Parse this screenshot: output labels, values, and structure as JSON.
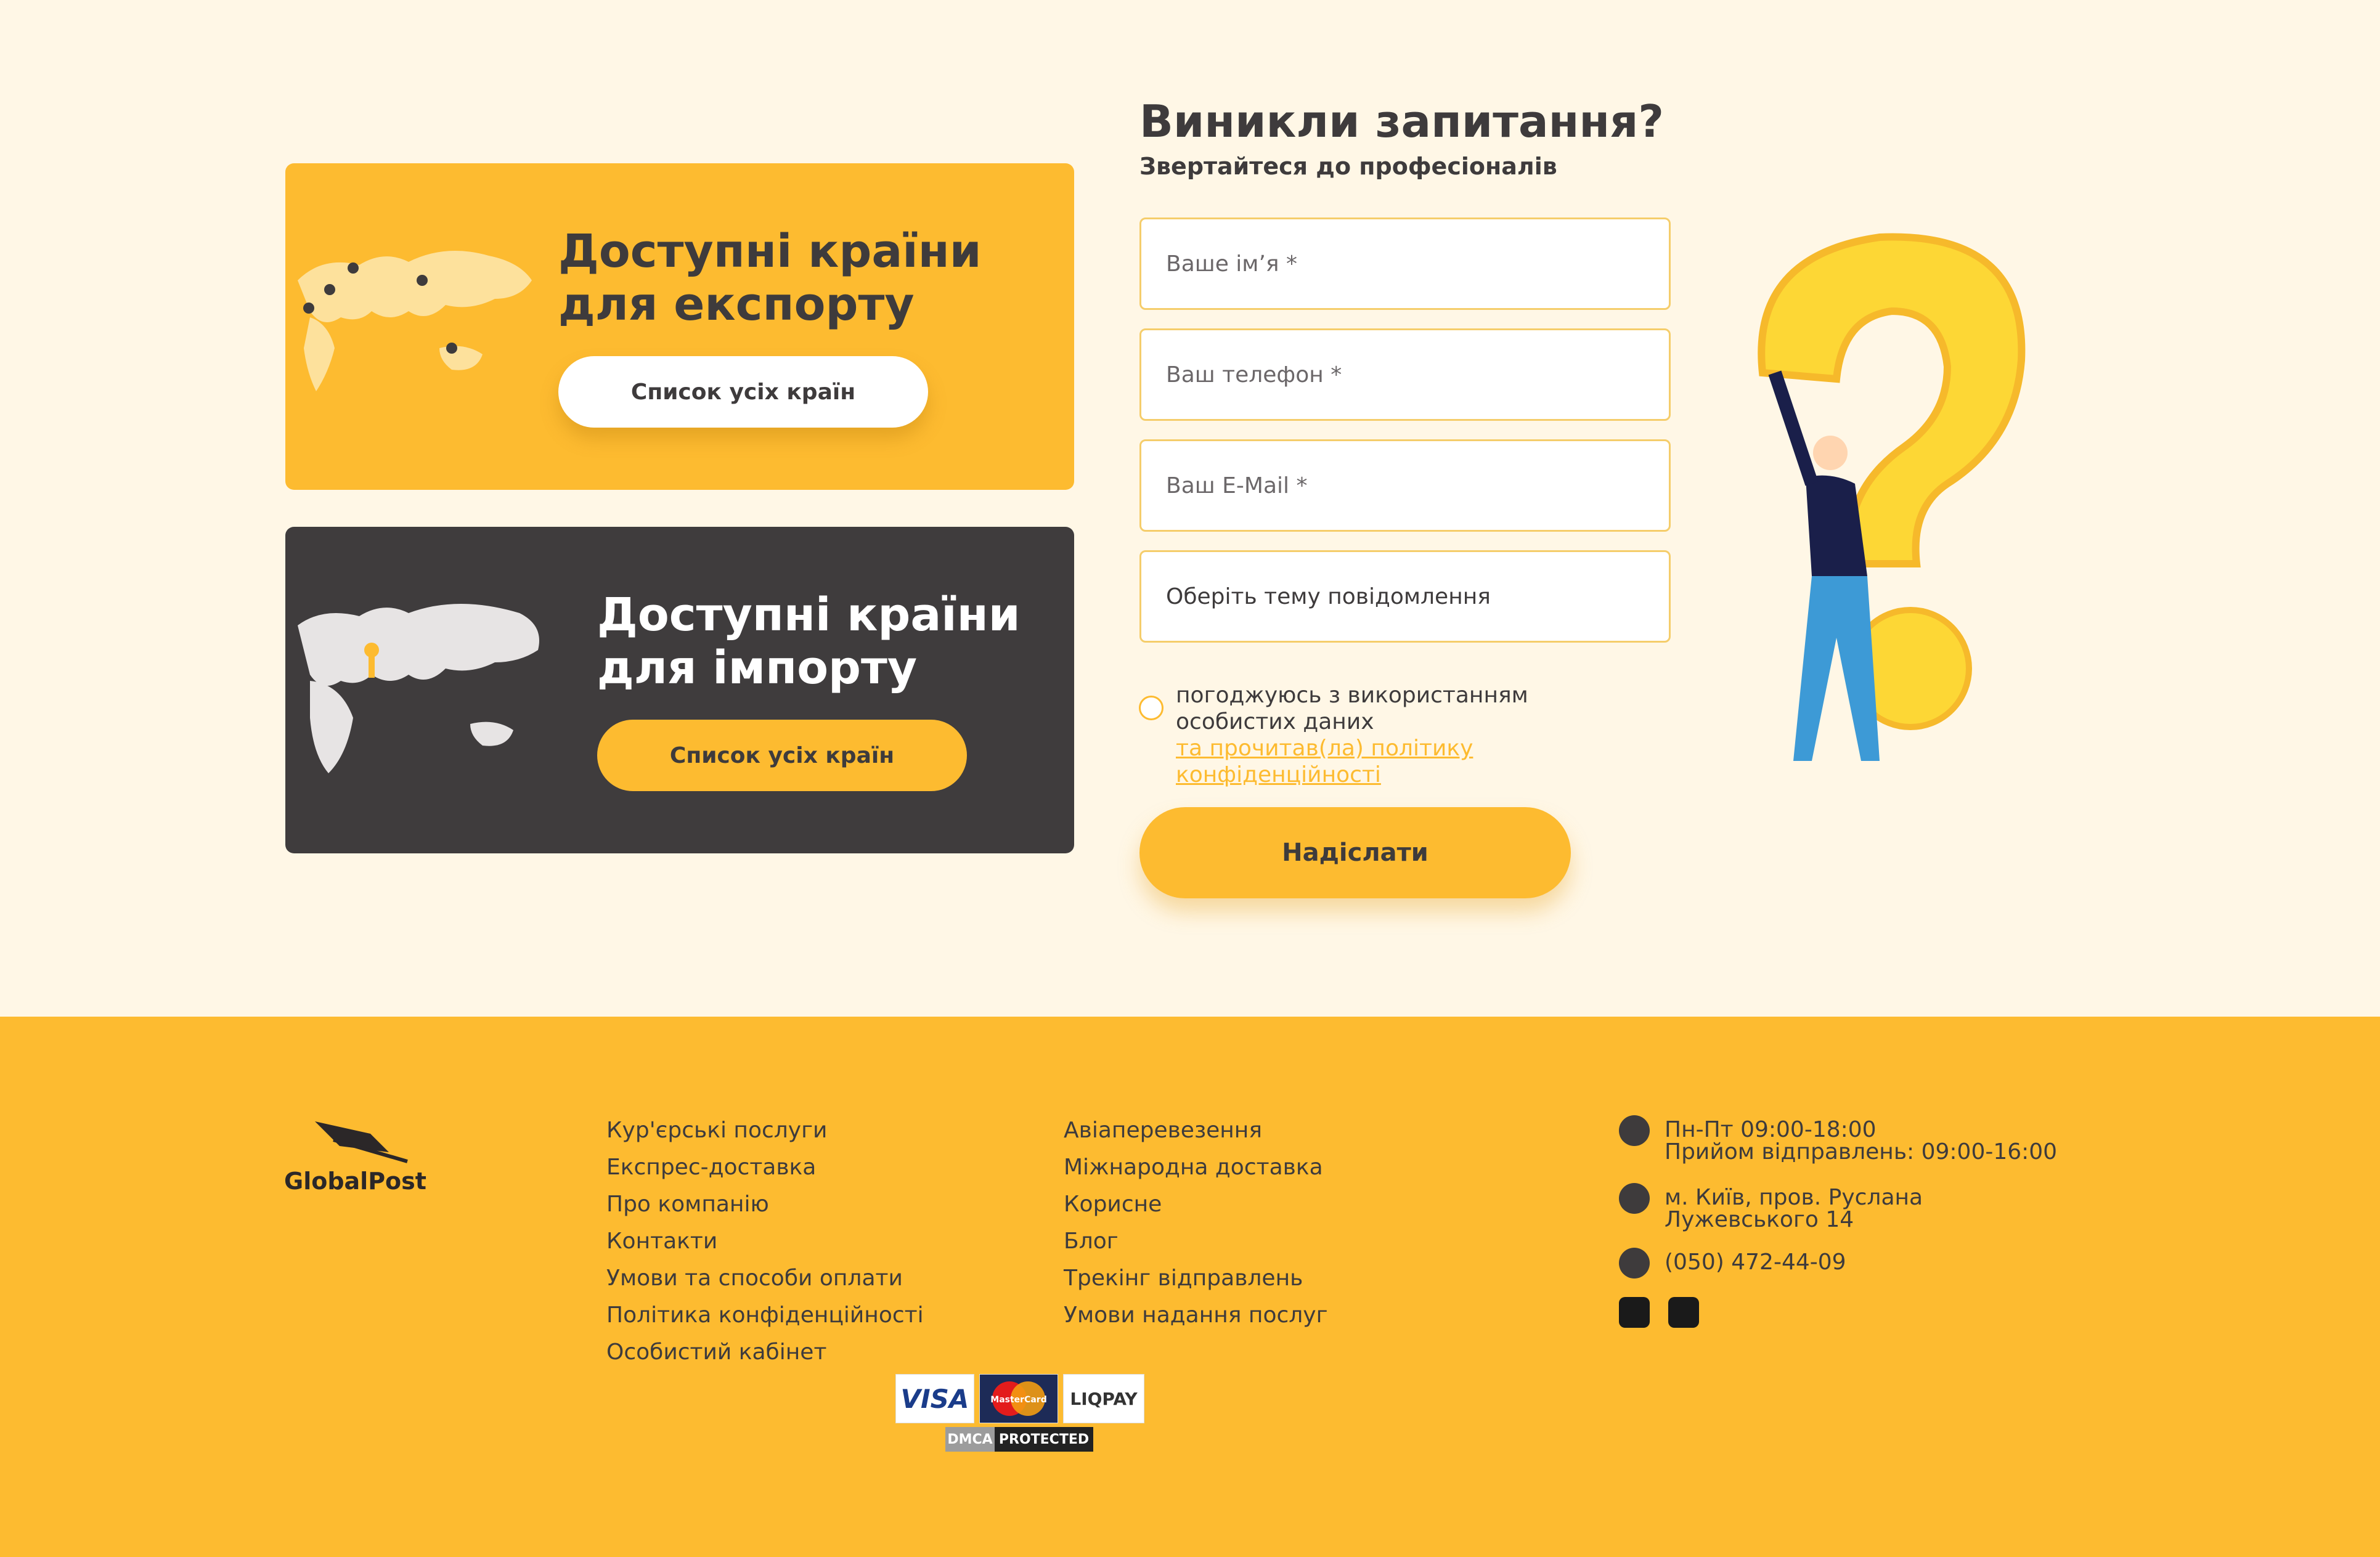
{
  "cards": {
    "export": {
      "title_line1": "Доступні країни",
      "title_line2": "для експорту",
      "button": "Список усіх країн"
    },
    "import": {
      "title_line1": "Доступні країни",
      "title_line2": "для імпорту",
      "button": "Список усіх країн"
    }
  },
  "form": {
    "title": "Виникли запитання?",
    "subtitle": "Звертайтеся до професіоналів",
    "name_placeholder": "Ваше ім’я *",
    "phone_placeholder": "Ваш телефон *",
    "email_placeholder": "Ваш E-Mail *",
    "topic_select": "Оберіть тему повідомлення",
    "consent_text": "погоджуюсь з використанням особистих даних",
    "consent_link": "та прочитав(ла) політику конфіденційності",
    "submit": "Надіслати"
  },
  "footer": {
    "logo_text": "GlobalPost",
    "col1": [
      "Кур'єрські послуги",
      "Експрес-доставка",
      "Про компанію",
      "Контакти",
      "Умови та способи оплати",
      "Політика конфіденційності",
      "Особистий кабінет"
    ],
    "col2": [
      "Авіаперевезення",
      "Міжнародна доставка",
      "Корисне",
      "Блог",
      "Трекінг відправлень",
      "Умови надання послуг"
    ],
    "hours_line1": "Пн-Пт 09:00-18:00",
    "hours_line2": "Прийом відправлень: 09:00-16:00",
    "address_line1": "м. Київ, пров. Руслана",
    "address_line2": "Лужевського 14",
    "phone": "(050) 472-44-09",
    "payments": {
      "visa": "VISA",
      "mastercard": "MasterCard",
      "liqpay": "LIQPAY",
      "dmca_left": "DMCA",
      "dmca_right": "PROTECTED"
    }
  },
  "colors": {
    "accent": "#fdbb30",
    "dark": "#3f3c3d",
    "background": "#fff7e6"
  }
}
